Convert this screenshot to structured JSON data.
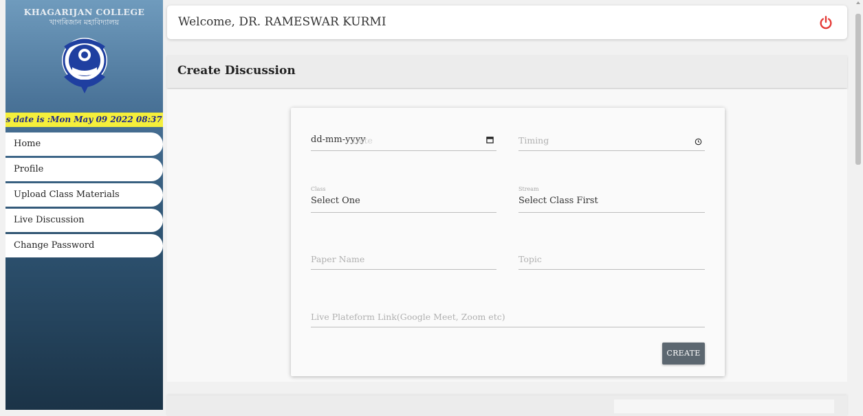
{
  "sidebar": {
    "college_name": "KHAGARIJAN COLLEGE",
    "college_name_assamese": "খাগৰিজান মহাবিদ্যালয়",
    "date_text": "'s date is :Mon May 09 2022 08:37",
    "items": [
      {
        "label": "Home"
      },
      {
        "label": "Profile"
      },
      {
        "label": "Upload Class Materials"
      },
      {
        "label": "Live Discussion"
      },
      {
        "label": "Change Password"
      }
    ]
  },
  "header": {
    "welcome": "Welcome, DR. RAMESWAR KURMI",
    "power_icon": "power-icon",
    "power_color": "#e53935"
  },
  "section": {
    "title": "Create Discussion"
  },
  "form": {
    "date": {
      "value": "dd-mm-yyyy",
      "placeholder": "Date"
    },
    "timing": {
      "placeholder": "Timing"
    },
    "class": {
      "label": "Class",
      "value": "Select One"
    },
    "stream": {
      "label": "Stream",
      "value": "Select Class First"
    },
    "paper_name": {
      "placeholder": "Paper Name"
    },
    "topic": {
      "placeholder": "Topic"
    },
    "link": {
      "placeholder": "Live Plateform Link(Google Meet, Zoom etc)"
    },
    "create_label": "CREATE"
  },
  "colors": {
    "accent_yellow": "#f5ef3b",
    "button": "#5c6770",
    "sidebar_top": "#6f9bbd",
    "sidebar_bottom": "#1b3347"
  }
}
